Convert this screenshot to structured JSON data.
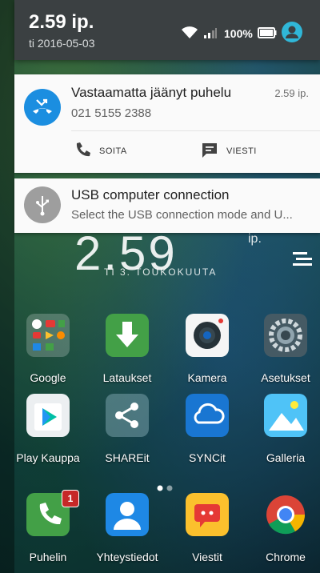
{
  "status_bar": {
    "time": "2.59 ip.",
    "date": "ti 2016-05-03",
    "battery": "100%"
  },
  "notifications": [
    {
      "title": "Vastaamatta jäänyt puhelu",
      "text": "021 5155 2388",
      "time": "2.59 ip.",
      "actions": [
        "SOITA",
        "VIESTI"
      ],
      "icon": "missed-call-icon"
    },
    {
      "title": "USB computer connection",
      "text": "Select the USB connection mode and U...",
      "icon": "usb-icon"
    }
  ],
  "home": {
    "clock": "2.59",
    "clock_suffix": "ip.",
    "date": "TI 3. TOUKOKUUTA",
    "apps_row1": [
      "Google",
      "Lataukset",
      "Kamera",
      "Asetukset"
    ],
    "apps_row2": [
      "Play Kauppa",
      "SHAREit",
      "SYNCit",
      "Galleria"
    ],
    "dock": [
      "Puhelin",
      "Yhteystiedot",
      "Viestit",
      "Chrome"
    ],
    "phone_badge": "1"
  },
  "colors": {
    "status_bg": "#3b4042",
    "accent_blue": "#1b8ee0",
    "avatar": "#30b7d8",
    "badge_red": "#c62828"
  }
}
